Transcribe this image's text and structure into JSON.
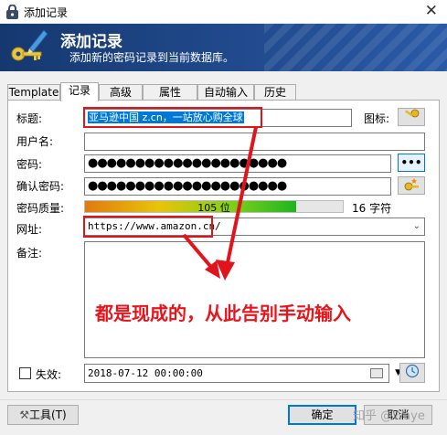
{
  "window": {
    "title": "添加记录"
  },
  "banner": {
    "title": "添加记录",
    "subtitle": "添加新的密码记录到当前数据库。"
  },
  "tabs": [
    {
      "label": "Template"
    },
    {
      "label": "记录"
    },
    {
      "label": "高级"
    },
    {
      "label": "属性"
    },
    {
      "label": "自动输入"
    },
    {
      "label": "历史"
    }
  ],
  "form": {
    "title_label": "标题:",
    "title_value": "亚马逊中国 z.cn，一站放心购全球",
    "icon_label": "图标:",
    "username_label": "用户名:",
    "username_value": "",
    "password_label": "密码:",
    "password_masked": "●●●●●●●●●●●●●●●●●●●●●",
    "reveal_label": "•••",
    "confirm_label": "确认密码:",
    "confirm_masked": "●●●●●●●●●●●●●●●●●●●●●",
    "quality_label": "密码质量:",
    "quality_text": "105 位",
    "quality_fraction": 0.82,
    "char_count": "16 字符",
    "url_label": "网址:",
    "url_value": "https://www.amazon.cn/",
    "notes_label": "备注:",
    "notes_value": "",
    "expires_label": "失效:",
    "expires_checked": false,
    "expires_value": "2018-07-12 00:00:00"
  },
  "annotation": {
    "text": "都是现成的，从此告别手动输入"
  },
  "footer": {
    "tools_label": "工具(T)",
    "ok_label": "确定",
    "cancel_label": "取消"
  },
  "watermark": "知乎 @Waye",
  "colors": {
    "banner": "#1e4486",
    "annotation_red": "#e2141b",
    "selection": "#0078d7"
  }
}
